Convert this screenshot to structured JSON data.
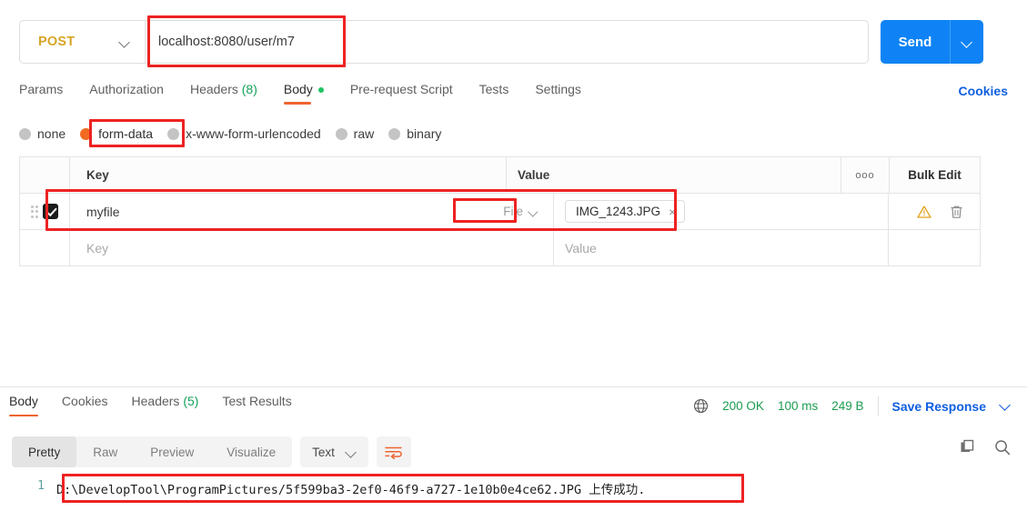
{
  "request": {
    "method": "POST",
    "url": "localhost:8080/user/m7",
    "send_label": "Send",
    "tabs": [
      {
        "label": "Params",
        "active": false
      },
      {
        "label": "Authorization",
        "active": false
      },
      {
        "label": "Headers",
        "count": "(8)",
        "active": false
      },
      {
        "label": "Body",
        "active": true,
        "dot": true
      },
      {
        "label": "Pre-request Script",
        "active": false
      },
      {
        "label": "Tests",
        "active": false
      },
      {
        "label": "Settings",
        "active": false
      }
    ],
    "cookies_link": "Cookies",
    "body_types": [
      {
        "label": "none",
        "selected": false
      },
      {
        "label": "form-data",
        "selected": true
      },
      {
        "label": "x-www-form-urlencoded",
        "selected": false
      },
      {
        "label": "raw",
        "selected": false
      },
      {
        "label": "binary",
        "selected": false
      }
    ],
    "table": {
      "headers": {
        "key": "Key",
        "value": "Value",
        "bulk_edit": "Bulk Edit",
        "more": "ooo"
      },
      "rows": [
        {
          "checked": true,
          "key": "myfile",
          "type": "File",
          "file_name": "IMG_1243.JPG",
          "remove_label": "×"
        }
      ],
      "placeholder_row": {
        "key": "Key",
        "value": "Value"
      }
    }
  },
  "response": {
    "tabs": [
      {
        "label": "Body",
        "active": true
      },
      {
        "label": "Cookies",
        "active": false
      },
      {
        "label": "Headers",
        "count": "(5)",
        "active": false
      },
      {
        "label": "Test Results",
        "active": false
      }
    ],
    "status": "200 OK",
    "time": "100 ms",
    "size": "249 B",
    "save_label": "Save Response",
    "view_modes": [
      {
        "label": "Pretty",
        "active": true
      },
      {
        "label": "Raw",
        "active": false
      },
      {
        "label": "Preview",
        "active": false
      },
      {
        "label": "Visualize",
        "active": false
      }
    ],
    "format": "Text",
    "line_number": "1",
    "body_text": "D:\\DevelopTool\\ProgramPictures/5f599ba3-2ef0-46f9-a727-1e10b0e4ce62.JPG 上传成功."
  },
  "colors": {
    "accent_orange": "#ef6330",
    "send_blue": "#0f83f5",
    "link_blue": "#0f5fe0",
    "method_amber": "#d9a527",
    "status_green": "#1a9c50",
    "annotation_red": "#ee2222"
  }
}
